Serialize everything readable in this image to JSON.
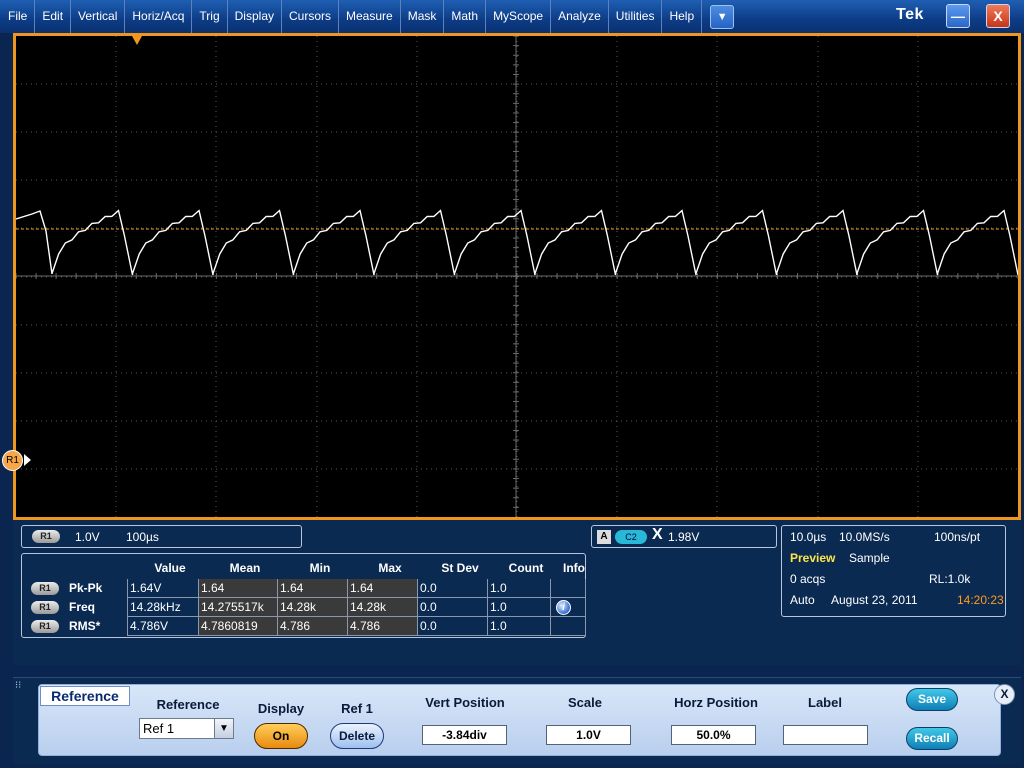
{
  "menu": [
    "File",
    "Edit",
    "Vertical",
    "Horiz/Acq",
    "Trig",
    "Display",
    "Cursors",
    "Measure",
    "Mask",
    "Math",
    "MyScope",
    "Analyze",
    "Utilities",
    "Help"
  ],
  "menu_dropdown_glyph": "▼",
  "brand": "Tek",
  "window_buttons": {
    "minimize": "—",
    "close": "X"
  },
  "screen": {
    "ref_marker": "R1",
    "trace_color": "#ffffff",
    "trigger_level_color": "#f0961e"
  },
  "channel": {
    "badge": "R1",
    "volts_per_div": "1.0V",
    "time_per_div": "100µs"
  },
  "measurements": {
    "headers": [
      "Value",
      "Mean",
      "Min",
      "Max",
      "St Dev",
      "Count",
      "Info"
    ],
    "rows": [
      {
        "badge": "R1",
        "name": "Pk-Pk",
        "value": "1.64V",
        "mean": "1.64",
        "min": "1.64",
        "max": "1.64",
        "stdev": "0.0",
        "count": "1.0",
        "info": ""
      },
      {
        "badge": "R1",
        "name": "Freq",
        "value": "14.28kHz",
        "mean": "14.275517k",
        "min": "14.28k",
        "max": "14.28k",
        "stdev": "0.0",
        "count": "1.0",
        "info": "info-icon"
      },
      {
        "badge": "R1",
        "name": "RMS*",
        "value": "4.786V",
        "mean": "4.7860819",
        "min": "4.786",
        "max": "4.786",
        "stdev": "0.0",
        "count": "1.0",
        "info": ""
      }
    ]
  },
  "trigger": {
    "mode": "A",
    "source": "C2",
    "slope_glyph": "X",
    "level": "1.98V"
  },
  "acquisition": {
    "time_scale": "10.0µs",
    "sample_rate": "10.0MS/s",
    "resolution": "100ns/pt",
    "state": "Preview",
    "mode": "Sample",
    "acqs": "0 acqs",
    "record_length": "RL:1.0k",
    "trigger_mode": "Auto",
    "date": "August 23, 2011",
    "time": "14:20:23"
  },
  "reference_panel": {
    "tab_title": "Reference",
    "reference_label": "Reference",
    "reference_value": "Ref 1",
    "display_label": "Display",
    "display_value": "On",
    "ref_label": "Ref 1",
    "delete_label": "Delete",
    "vert_position_label": "Vert Position",
    "vert_position_value": "-3.84div",
    "scale_label": "Scale",
    "scale_value": "1.0V",
    "horz_position_label": "Horz Position",
    "horz_position_value": "50.0%",
    "label_label": "Label",
    "label_value": "",
    "save_label": "Save",
    "recall_label": "Recall",
    "close_label": "X"
  }
}
